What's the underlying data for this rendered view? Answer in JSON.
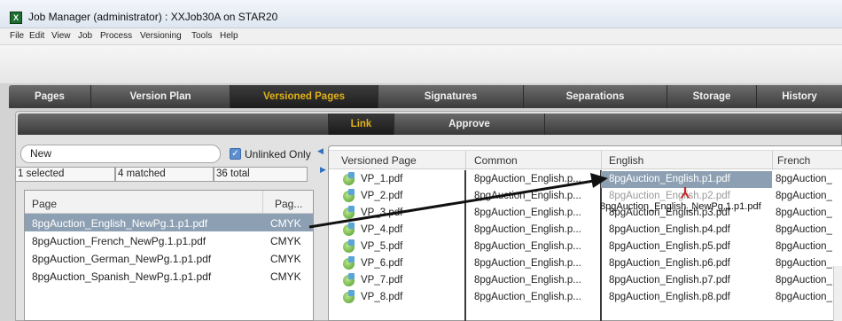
{
  "window": {
    "title": "Job Manager (administrator) : XXJob30A on STAR20",
    "app_icon_glyph": "X"
  },
  "menu": [
    "File",
    "Edit",
    "View",
    "Job",
    "Process",
    "Versioning",
    "Tools",
    "Help"
  ],
  "main_tabs": [
    {
      "label": "Pages",
      "active": false
    },
    {
      "label": "Version Plan",
      "active": false
    },
    {
      "label": "Versioned Pages",
      "active": true
    },
    {
      "label": "Signatures",
      "active": false
    },
    {
      "label": "Separations",
      "active": false
    },
    {
      "label": "Storage",
      "active": false
    },
    {
      "label": "History",
      "active": false
    }
  ],
  "sub_tabs": [
    {
      "label": "Link",
      "active": true
    },
    {
      "label": "Approve",
      "active": false
    }
  ],
  "filter": {
    "search_value": "New",
    "unlinked_only_label": "Unlinked Only",
    "unlinked_only_checked": true
  },
  "stats": {
    "selected": "1 selected",
    "matched": "4 matched",
    "total": "36 total"
  },
  "pages_table": {
    "columns": [
      "Page",
      "Pag..."
    ],
    "rows": [
      {
        "page": "8pgAuction_English_NewPg.1.p1.pdf",
        "color": "CMYK",
        "selected": true
      },
      {
        "page": "8pgAuction_French_NewPg.1.p1.pdf",
        "color": "CMYK",
        "selected": false
      },
      {
        "page": "8pgAuction_German_NewPg.1.p1.pdf",
        "color": "CMYK",
        "selected": false
      },
      {
        "page": "8pgAuction_Spanish_NewPg.1.p1.pdf",
        "color": "CMYK",
        "selected": false
      }
    ]
  },
  "versioned_table": {
    "columns": [
      "Versioned Page",
      "Common",
      "English",
      "French"
    ],
    "rows": [
      {
        "vp": "VP_1.pdf",
        "common": "8pgAuction_English.p...",
        "english": "8pgAuction_English.p1.pdf",
        "french": "8pgAuction_"
      },
      {
        "vp": "VP_2.pdf",
        "common": "8pgAuction_English.p...",
        "english": "8pgAuction_English.p2.pdf",
        "french": "8pgAuction_"
      },
      {
        "vp": "VP_3.pdf",
        "common": "8pgAuction_English.p...",
        "english": "8pgAuction_English.p3.pdf",
        "french": "8pgAuction_"
      },
      {
        "vp": "VP_4.pdf",
        "common": "8pgAuction_English.p...",
        "english": "8pgAuction_English.p4.pdf",
        "french": "8pgAuction_"
      },
      {
        "vp": "VP_5.pdf",
        "common": "8pgAuction_English.p...",
        "english": "8pgAuction_English.p5.pdf",
        "french": "8pgAuction_"
      },
      {
        "vp": "VP_6.pdf",
        "common": "8pgAuction_English.p...",
        "english": "8pgAuction_English.p6.pdf",
        "french": "8pgAuction_"
      },
      {
        "vp": "VP_7.pdf",
        "common": "8pgAuction_English.p...",
        "english": "8pgAuction_English.p7.pdf",
        "french": "8pgAuction_"
      },
      {
        "vp": "VP_8.pdf",
        "common": "8pgAuction_English.p...",
        "english": "8pgAuction_English.p8.pdf",
        "french": "8pgAuction_"
      }
    ]
  },
  "drag": {
    "label": "8pgAuction_English_NewPg.1.p1.pdf",
    "icon": "pdf-icon"
  },
  "colors": {
    "active_tab_text": "#e2b218",
    "selection": "#8da0b3",
    "tab_bar": "#3c3c3c"
  }
}
